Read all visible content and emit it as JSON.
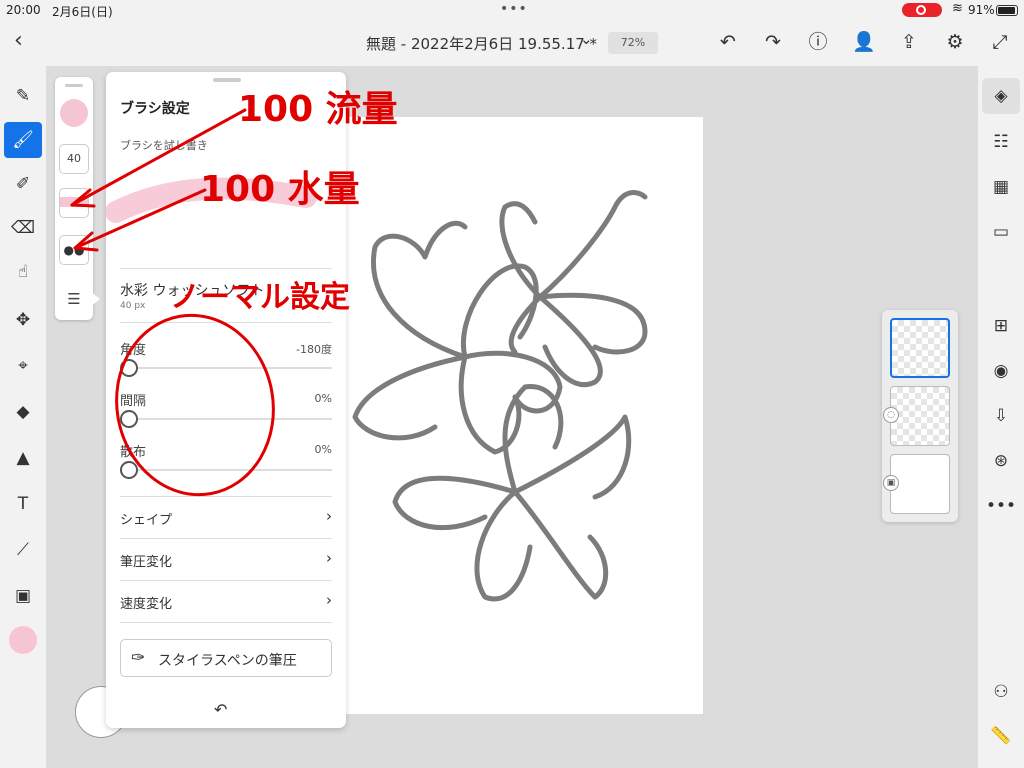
{
  "status": {
    "time": "20:00",
    "date": "2月6日(日)",
    "battery": "91%"
  },
  "topbar": {
    "title": "無題 - 2022年2月6日 19.55.17 *",
    "zoom": "72%"
  },
  "brush_panel": {
    "title": "ブラシ設定",
    "subtitle": "ブラシを試し書き",
    "size_value": "40",
    "brush_name": "水彩 ウォッシュソフト",
    "brush_size": "40 px",
    "sliders": [
      {
        "label": "角度",
        "value": "-180度"
      },
      {
        "label": "間隔",
        "value": "0%"
      },
      {
        "label": "散布",
        "value": "0%"
      }
    ],
    "rows": [
      {
        "label": "シェイプ"
      },
      {
        "label": "筆圧変化"
      },
      {
        "label": "速度変化"
      }
    ],
    "stylus_label": "スタイラスペンの筆圧"
  },
  "annotations": {
    "flow": "100 流量",
    "water": "100 水量",
    "normal": "ノーマル設定"
  },
  "colors": {
    "accent": "#1473e6",
    "brush_color": "#f6c5d3",
    "annotation": "#e00000"
  }
}
